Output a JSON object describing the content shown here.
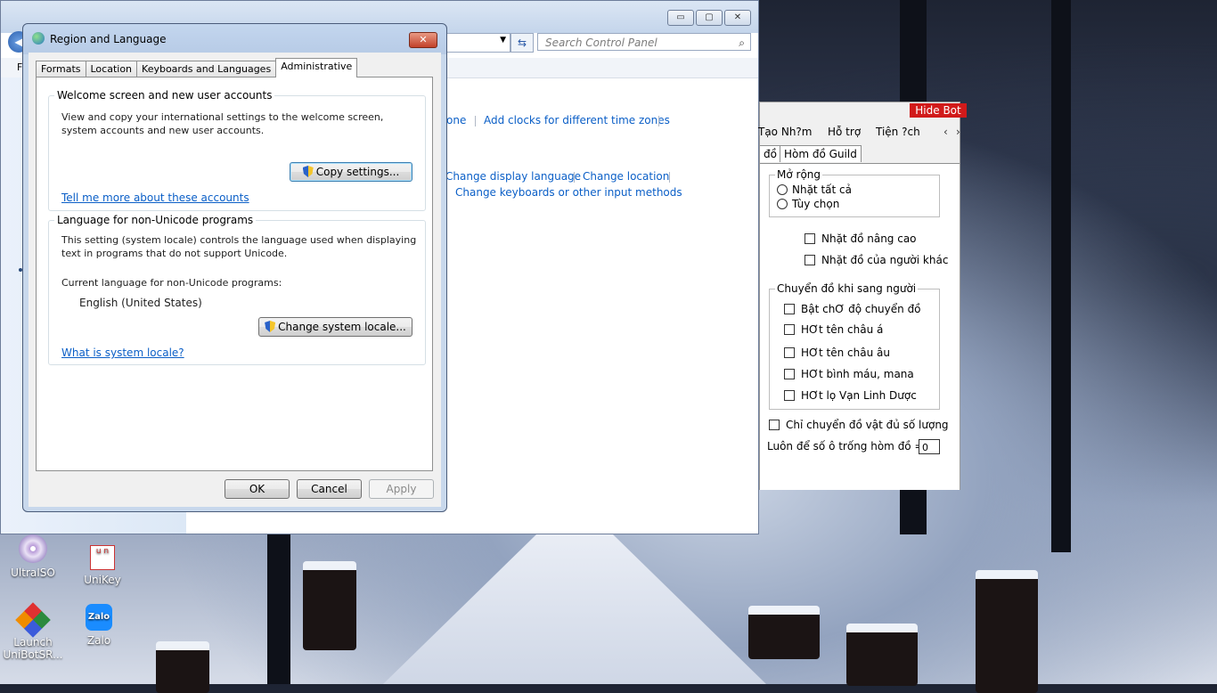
{
  "control_panel": {
    "search_placeholder": "Search Control Panel",
    "menu_letter": "F",
    "links": {
      "time_zone_tail": "one",
      "add_clocks": "Add clocks for different time zones",
      "change_display_language": "Change display language",
      "change_location": "Change location",
      "change_keyboards": "Change keyboards or other input methods"
    },
    "buttons": {
      "minimize": "▭",
      "restore": "▢",
      "close": "✕"
    }
  },
  "dialog": {
    "title": "Region and Language",
    "close_label": "✕",
    "tabs": [
      "Formats",
      "Location",
      "Keyboards and Languages",
      "Administrative"
    ],
    "active_tab": "Administrative",
    "welcome_group": {
      "title": "Welcome screen and new user accounts",
      "description": "View and copy your international settings to the welcome screen, system accounts and new user accounts.",
      "button": "Copy settings...",
      "link": "Tell me more about these accounts"
    },
    "locale_group": {
      "title": "Language for non-Unicode programs",
      "description": "This setting (system locale) controls the language used when displaying text in programs that do not support Unicode.",
      "current_label": "Current language for non-Unicode programs:",
      "current_value": "English (United States)",
      "button": "Change system locale...",
      "link": "What is system locale?"
    },
    "footer": {
      "ok": "OK",
      "cancel": "Cancel",
      "apply": "Apply"
    }
  },
  "bot": {
    "hide_button": "Hide Bot",
    "menu": [
      "Tạo Nh?m",
      "Hỗ trợ",
      "Tiện ?ch"
    ],
    "arrows": {
      "left": "‹",
      "right": "›"
    },
    "tabs": [
      "đồ",
      "Hòm đồ Guild"
    ],
    "expand_group": {
      "title": "Mở rộng",
      "options": [
        "Nhặt tất cả",
        "Tùy chọn"
      ]
    },
    "checks": [
      "Nhặt đồ nâng cao",
      "Nhặt đồ của người khác"
    ],
    "transfer_group": {
      "title": "Chuyển đồ khi sang người",
      "options": [
        "Bật chƠ độ chuyển đồ",
        "HƠt tên châu á",
        "HƠt tên châu âu",
        "HƠt bình máu, mana",
        "HƠt lọ Vạn Linh Dược"
      ]
    },
    "only_enough": "Chỉ chuyển đồ vật đủ số lượng",
    "empty_slots_label": "Luôn để số ô trống  hòm đồ =",
    "empty_slots_value": "0"
  },
  "desktop_icons": [
    {
      "name": "UltraISO"
    },
    {
      "name": "UniKey"
    },
    {
      "name": "Launch UniBotSR..."
    },
    {
      "name": "Zalo"
    }
  ]
}
